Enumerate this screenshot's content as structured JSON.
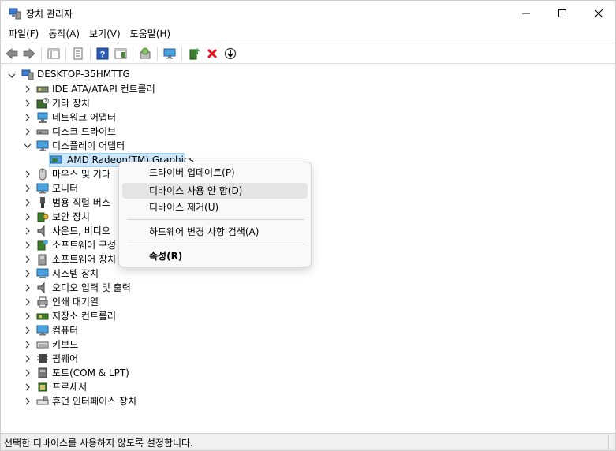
{
  "window": {
    "title": "장치 관리자"
  },
  "menu": [
    "파일(F)",
    "동작(A)",
    "보기(V)",
    "도움말(H)"
  ],
  "tree": {
    "root": "DESKTOP-35HMTTG",
    "items": [
      {
        "label": "IDE ATA/ATAPI 컨트롤러",
        "icon": "ide-controller-icon"
      },
      {
        "label": "기타 장치",
        "icon": "unknown-device-icon"
      },
      {
        "label": "네트워크 어댑터",
        "icon": "network-adapter-icon"
      },
      {
        "label": "디스크 드라이브",
        "icon": "disk-drive-icon"
      },
      {
        "label": "디스플레이 어댑터",
        "icon": "display-adapter-icon",
        "expanded": true
      },
      {
        "label": "AMD Radeon(TM) Graphics",
        "icon": "display-card-icon",
        "child": true,
        "selected": true
      },
      {
        "label": "마우스 및 기타",
        "icon": "mouse-icon"
      },
      {
        "label": "모니터",
        "icon": "monitor-icon"
      },
      {
        "label": "범용 직렬 버스",
        "icon": "usb-icon"
      },
      {
        "label": "보안 장치",
        "icon": "security-device-icon"
      },
      {
        "label": "사운드, 비디오",
        "icon": "speaker-icon"
      },
      {
        "label": "소프트웨어 구성",
        "icon": "software-component-icon"
      },
      {
        "label": "소프트웨어 장치",
        "icon": "software-device-icon"
      },
      {
        "label": "시스템 장치",
        "icon": "system-device-icon"
      },
      {
        "label": "오디오 입력 및 출력",
        "icon": "audio-io-icon"
      },
      {
        "label": "인쇄 대기열",
        "icon": "printer-icon"
      },
      {
        "label": "저장소 컨트롤러",
        "icon": "storage-controller-icon"
      },
      {
        "label": "컴퓨터",
        "icon": "computer-icon"
      },
      {
        "label": "키보드",
        "icon": "keyboard-icon"
      },
      {
        "label": "펌웨어",
        "icon": "firmware-icon"
      },
      {
        "label": "포트(COM & LPT)",
        "icon": "port-icon"
      },
      {
        "label": "프로세서",
        "icon": "processor-icon"
      },
      {
        "label": "휴먼 인터페이스 장치",
        "icon": "hid-icon"
      }
    ]
  },
  "context_menu": {
    "update_driver": "드라이버 업데이트(P)",
    "disable_device": "디바이스 사용 안 함(D)",
    "uninstall_device": "디바이스 제거(U)",
    "scan_changes": "하드웨어 변경 사항 검색(A)",
    "properties": "속성(R)"
  },
  "status": {
    "text": "선택한 디바이스를 사용하지 않도록 설정합니다."
  },
  "colors": {
    "selection_bg": "#cce8ff",
    "selection_border": "#99d1ff",
    "hover_bg": "#e5e5e5",
    "uninstall_red": "#e81123",
    "help_blue": "#2b5db9"
  }
}
